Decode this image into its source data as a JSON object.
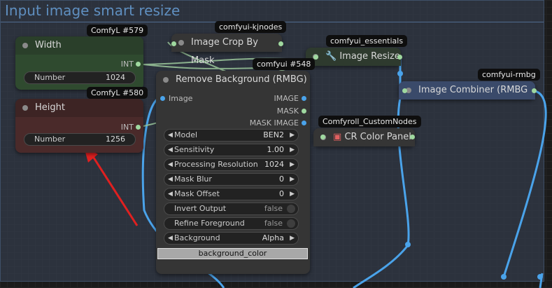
{
  "group": {
    "title": "Input image smart resize"
  },
  "nodes": {
    "width": {
      "title": "Width",
      "badge": "ComfyL  #579",
      "output": "INT",
      "field_label": "Number",
      "field_value": "1024",
      "color": "#2f4a2f"
    },
    "height": {
      "title": "Height",
      "badge": "ComfyL  #580",
      "output": "INT",
      "field_label": "Number",
      "field_value": "1256",
      "color": "#4a2a2a"
    },
    "crop": {
      "title": "Image Crop By Mask",
      "badge": "comfyui-kjnodes"
    },
    "resize": {
      "title": "Image Resize",
      "badge": "comfyui_essentials",
      "icon": "wrench-icon"
    },
    "combiner": {
      "title": "Image Combiner (RMBG",
      "badge": "comfyui-rmbg"
    },
    "color_panel": {
      "title": "CR Color Panel",
      "badge": "Comfyroll_CustomNodes"
    },
    "remove_bg": {
      "title": "Remove Background (RMBG)",
      "badge": "comfyui  #548",
      "input": "Image",
      "outputs": [
        "IMAGE",
        "MASK",
        "MASK IMAGE"
      ],
      "widgets": [
        {
          "label": "Model",
          "value": "BEN2",
          "kind": "combo"
        },
        {
          "label": "Sensitivity",
          "value": "1.00",
          "kind": "number"
        },
        {
          "label": "Processing Resolution",
          "value": "1024",
          "kind": "number"
        },
        {
          "label": "Mask Blur",
          "value": "0",
          "kind": "number"
        },
        {
          "label": "Mask Offset",
          "value": "0",
          "kind": "number"
        },
        {
          "label": "Invert Output",
          "value": "false",
          "kind": "toggle"
        },
        {
          "label": "Refine Foreground",
          "value": "false",
          "kind": "toggle"
        },
        {
          "label": "Background",
          "value": "Alpha",
          "kind": "combo"
        }
      ],
      "color_field": "background_color"
    }
  },
  "colors": {
    "wire": "#4aa3ea",
    "annotation_arrow": "#e02020"
  }
}
